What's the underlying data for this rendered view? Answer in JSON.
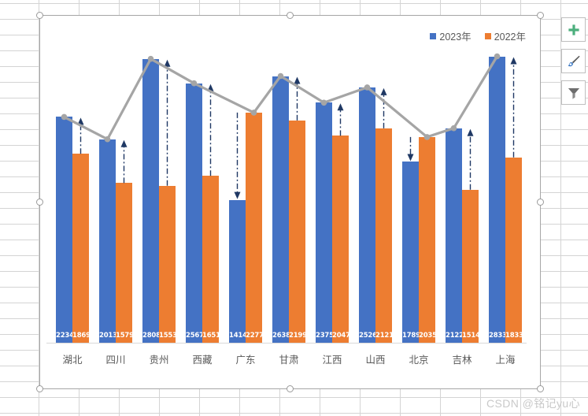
{
  "app": {
    "context": "excel-worksheet",
    "watermark": "CSDN @铭记yu心"
  },
  "chart": {
    "legend": [
      {
        "label": "2023年",
        "color": "#4472C4"
      },
      {
        "label": "2022年",
        "color": "#ED7D31"
      }
    ],
    "line_color": "#A5A5A5",
    "arrow_color": "#1F3864",
    "selected": true
  },
  "side_buttons": [
    {
      "name": "chart-elements-button",
      "icon": "plus-icon",
      "glyph": "+"
    },
    {
      "name": "chart-styles-button",
      "icon": "paintbrush-icon",
      "glyph": "✎"
    },
    {
      "name": "chart-filters-button",
      "icon": "funnel-icon",
      "glyph": "▼"
    }
  ],
  "chart_data": {
    "type": "bar",
    "title": "",
    "xlabel": "",
    "ylabel": "",
    "ylim": [
      0,
      3400
    ],
    "grid": false,
    "legend_position": "top-right",
    "categories": [
      "湖北",
      "四川",
      "贵州",
      "西藏",
      "广东",
      "甘肃",
      "江西",
      "山西",
      "北京",
      "吉林",
      "上海"
    ],
    "series": [
      {
        "name": "2023年",
        "color": "#4472C4",
        "values": [
          2234,
          2013,
          2808,
          2567,
          1414,
          2638,
          2375,
          2526,
          1789,
          2122,
          2833
        ]
      },
      {
        "name": "2022年",
        "color": "#ED7D31",
        "values": [
          1869,
          1579,
          1553,
          1651,
          2277,
          2199,
          2047,
          2121,
          2035,
          1514,
          1833
        ]
      }
    ],
    "overlay_line": {
      "name": "max-line",
      "type": "line",
      "color": "#A5A5A5",
      "marker": "circle",
      "values": [
        2234,
        2013,
        2808,
        2567,
        2277,
        2638,
        2375,
        2526,
        2035,
        2122,
        2833
      ]
    },
    "arrows": {
      "name": "difference-arrows",
      "style": "dash-dot",
      "color": "#1F3864",
      "items": [
        {
          "category": "湖北",
          "from": 1869,
          "to": 2234,
          "direction": "up"
        },
        {
          "category": "四川",
          "from": 1579,
          "to": 2013,
          "direction": "up"
        },
        {
          "category": "贵州",
          "from": 1553,
          "to": 2808,
          "direction": "up"
        },
        {
          "category": "西藏",
          "from": 1651,
          "to": 2567,
          "direction": "up"
        },
        {
          "category": "广东",
          "from": 2277,
          "to": 1414,
          "direction": "down"
        },
        {
          "category": "甘肃",
          "from": 2199,
          "to": 2638,
          "direction": "up"
        },
        {
          "category": "江西",
          "from": 2047,
          "to": 2375,
          "direction": "up"
        },
        {
          "category": "山西",
          "from": 2121,
          "to": 2526,
          "direction": "up"
        },
        {
          "category": "北京",
          "from": 2035,
          "to": 1789,
          "direction": "down"
        },
        {
          "category": "吉林",
          "from": 1514,
          "to": 2122,
          "direction": "up"
        },
        {
          "category": "上海",
          "from": 1833,
          "to": 2833,
          "direction": "up"
        }
      ]
    }
  }
}
